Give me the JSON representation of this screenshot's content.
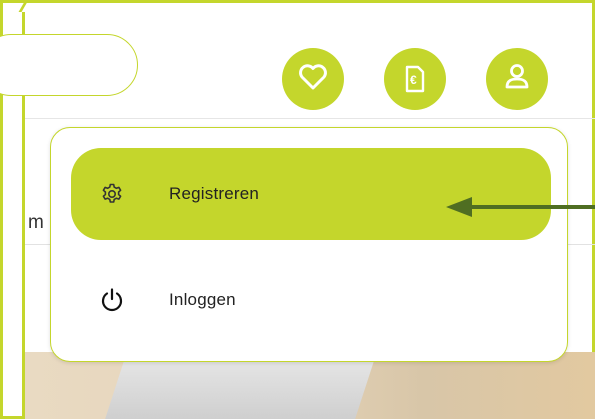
{
  "header": {
    "icons": [
      {
        "name": "heart-icon"
      },
      {
        "name": "invoice-euro-icon",
        "text": "€"
      },
      {
        "name": "user-icon"
      }
    ]
  },
  "content": {
    "partial_text": "m"
  },
  "dropdown": {
    "items": [
      {
        "label": "Registreren",
        "icon": "gear-icon",
        "active": true
      },
      {
        "label": "Inloggen",
        "icon": "power-icon",
        "active": false
      }
    ]
  },
  "colors": {
    "accent": "#c4d62c",
    "arrow": "#4f6e22"
  }
}
